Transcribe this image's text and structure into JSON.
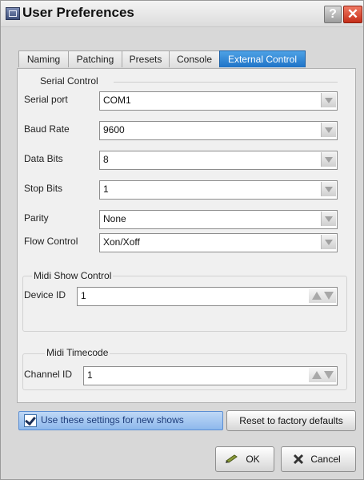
{
  "window": {
    "title": "User Preferences",
    "help_glyph": "?",
    "close_glyph": "✕"
  },
  "tabs": [
    {
      "label": "Naming"
    },
    {
      "label": "Patching"
    },
    {
      "label": "Presets"
    },
    {
      "label": "Console"
    },
    {
      "label": "External Control",
      "active": true
    }
  ],
  "serial_control": {
    "title": "Serial Control",
    "fields": [
      {
        "label": "Serial port",
        "value": "COM1"
      },
      {
        "label": "Baud Rate",
        "value": "9600"
      },
      {
        "label": "Data Bits",
        "value": "8"
      },
      {
        "label": "Stop Bits",
        "value": "1"
      },
      {
        "label": "Parity",
        "value": "None"
      },
      {
        "label": "Flow Control",
        "value": "Xon/Xoff"
      }
    ]
  },
  "midi_show_control": {
    "title": "Midi Show Control",
    "device_label": "Device ID",
    "device_value": "1"
  },
  "midi_timecode": {
    "title": "Midi Timecode",
    "channel_label": "Channel ID",
    "channel_value": "1"
  },
  "footer": {
    "use_settings_label": "Use these settings for new shows",
    "use_settings_checked": true,
    "reset_label": "Reset to factory defaults",
    "ok_label": "OK",
    "cancel_label": "Cancel"
  },
  "icons": {
    "title": "app-window-icon",
    "help": "help-icon",
    "close": "close-icon",
    "ok": "pencil-check-icon",
    "cancel": "cross-icon"
  },
  "colors": {
    "active_tab": "#2f86d6",
    "close_button": "#d94a32",
    "checkbox_highlight": "#9ec3ef"
  }
}
